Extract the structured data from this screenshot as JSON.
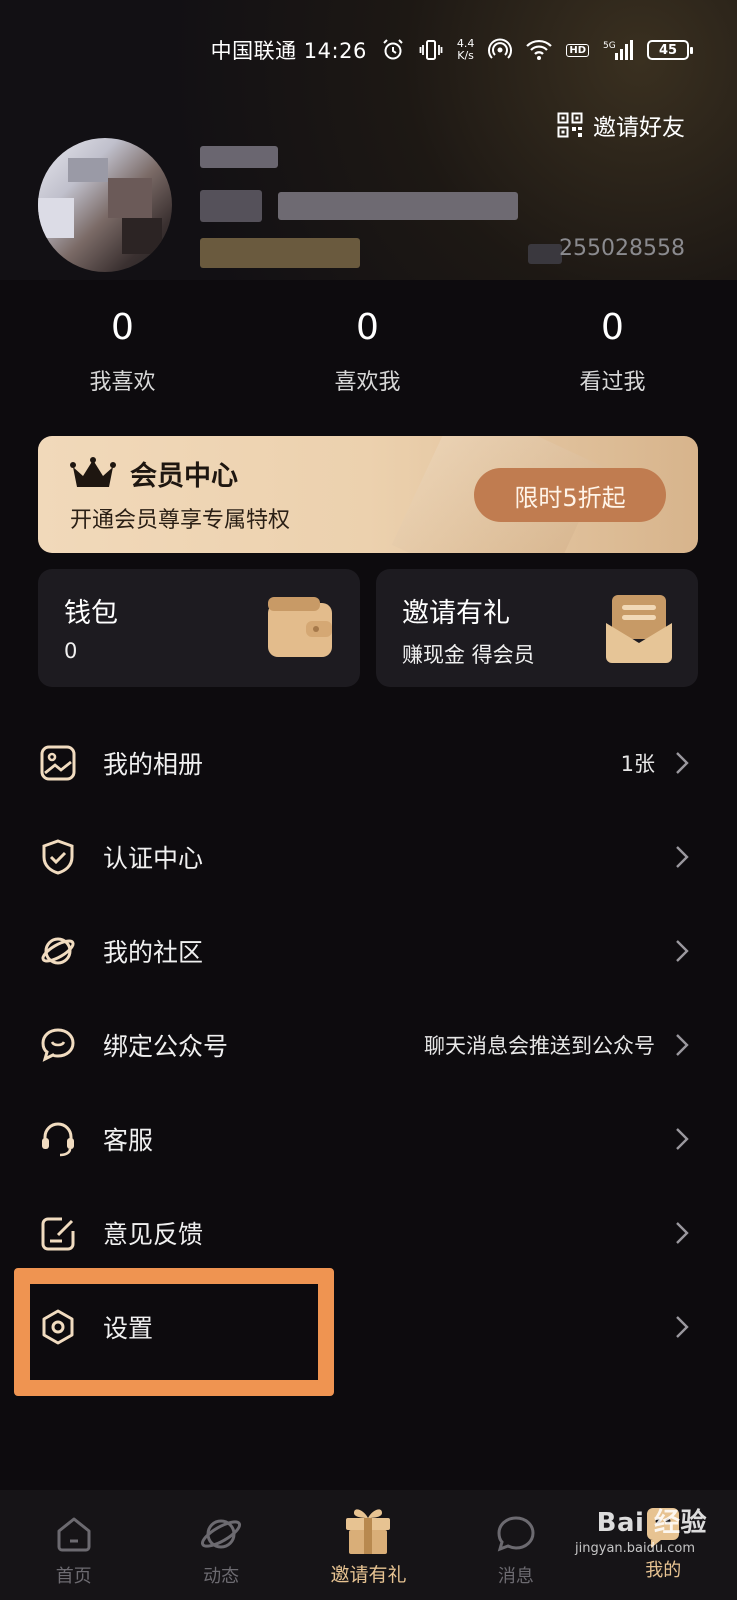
{
  "status_bar": {
    "carrier_time": "中国联通 14:26",
    "speed_value": "4.4",
    "speed_unit": "K/s",
    "hd_badge": "HD",
    "signal_label": "5G",
    "battery": "45"
  },
  "header": {
    "invite_friends": "邀请好友",
    "user_id": "255028558"
  },
  "stats": [
    {
      "value": "0",
      "label": "我喜欢"
    },
    {
      "value": "0",
      "label": "喜欢我"
    },
    {
      "value": "0",
      "label": "看过我"
    }
  ],
  "vip": {
    "title": "会员中心",
    "subtitle": "开通会员尊享专属特权",
    "cta": "限时5折起"
  },
  "cards": {
    "wallet": {
      "title": "钱包",
      "value": "0"
    },
    "invite": {
      "title": "邀请有礼",
      "subtitle": "赚现金 得会员"
    }
  },
  "menu": [
    {
      "label": "我的相册",
      "trail": "1张",
      "icon": "album-icon"
    },
    {
      "label": "认证中心",
      "trail": "",
      "icon": "shield-check-icon"
    },
    {
      "label": "我的社区",
      "trail": "",
      "icon": "planet-icon"
    },
    {
      "label": "绑定公众号",
      "trail": "聊天消息会推送到公众号",
      "icon": "chat-bubble-icon"
    },
    {
      "label": "客服",
      "trail": "",
      "icon": "headset-icon"
    },
    {
      "label": "意见反馈",
      "trail": "",
      "icon": "feedback-icon"
    },
    {
      "label": "设置",
      "trail": "",
      "icon": "settings-icon"
    }
  ],
  "bottom_nav": [
    {
      "label": "首页",
      "icon": "home-icon"
    },
    {
      "label": "动态",
      "icon": "planet-icon"
    },
    {
      "label": "邀请有礼",
      "icon": "gift-icon",
      "active": true
    },
    {
      "label": "消息",
      "icon": "message-icon"
    },
    {
      "label": "我的",
      "icon": "profile-icon"
    }
  ],
  "watermark": {
    "brand": "Bai 经验",
    "url": "jingyan.baidu.com"
  },
  "colors": {
    "accent": "#e7c392",
    "highlight": "#ef9451",
    "cta": "#c07c50",
    "background": "#0d0b0e"
  }
}
